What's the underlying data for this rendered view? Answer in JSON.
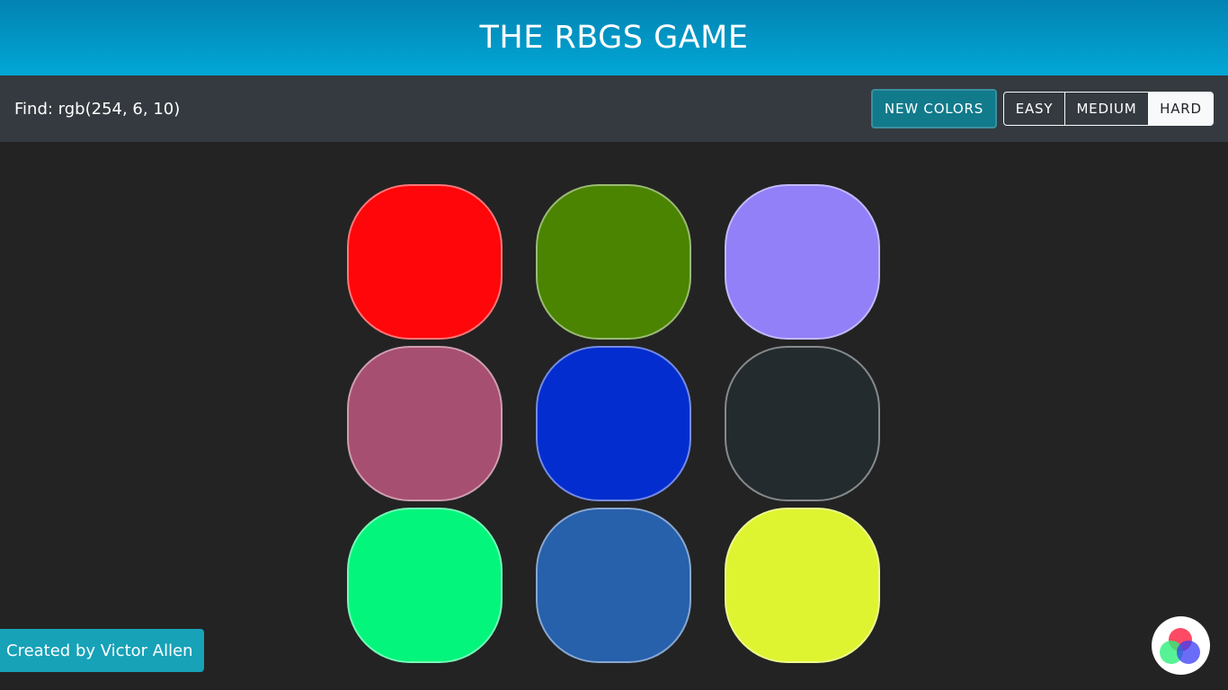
{
  "header": {
    "title": "THE RBGS GAME"
  },
  "toolbar": {
    "find_label": "Find: rgb(254, 6, 10)",
    "new_colors_label": "NEW COLORS",
    "modes": [
      {
        "label": "EASY",
        "active": false
      },
      {
        "label": "MEDIUM",
        "active": false
      },
      {
        "label": "HARD",
        "active": true
      }
    ]
  },
  "board": {
    "squares": [
      {
        "color": "#fe060a"
      },
      {
        "color": "#4a8400"
      },
      {
        "color": "#9180f7"
      },
      {
        "color": "#a74f70"
      },
      {
        "color": "#032dce"
      },
      {
        "color": "#242b2f"
      },
      {
        "color": "#04f57c"
      },
      {
        "color": "#2760ab"
      },
      {
        "color": "#dff430"
      }
    ]
  },
  "footer": {
    "credit": "Created by Victor Allen",
    "logo_icon": "rgb-circles-logo-icon"
  }
}
